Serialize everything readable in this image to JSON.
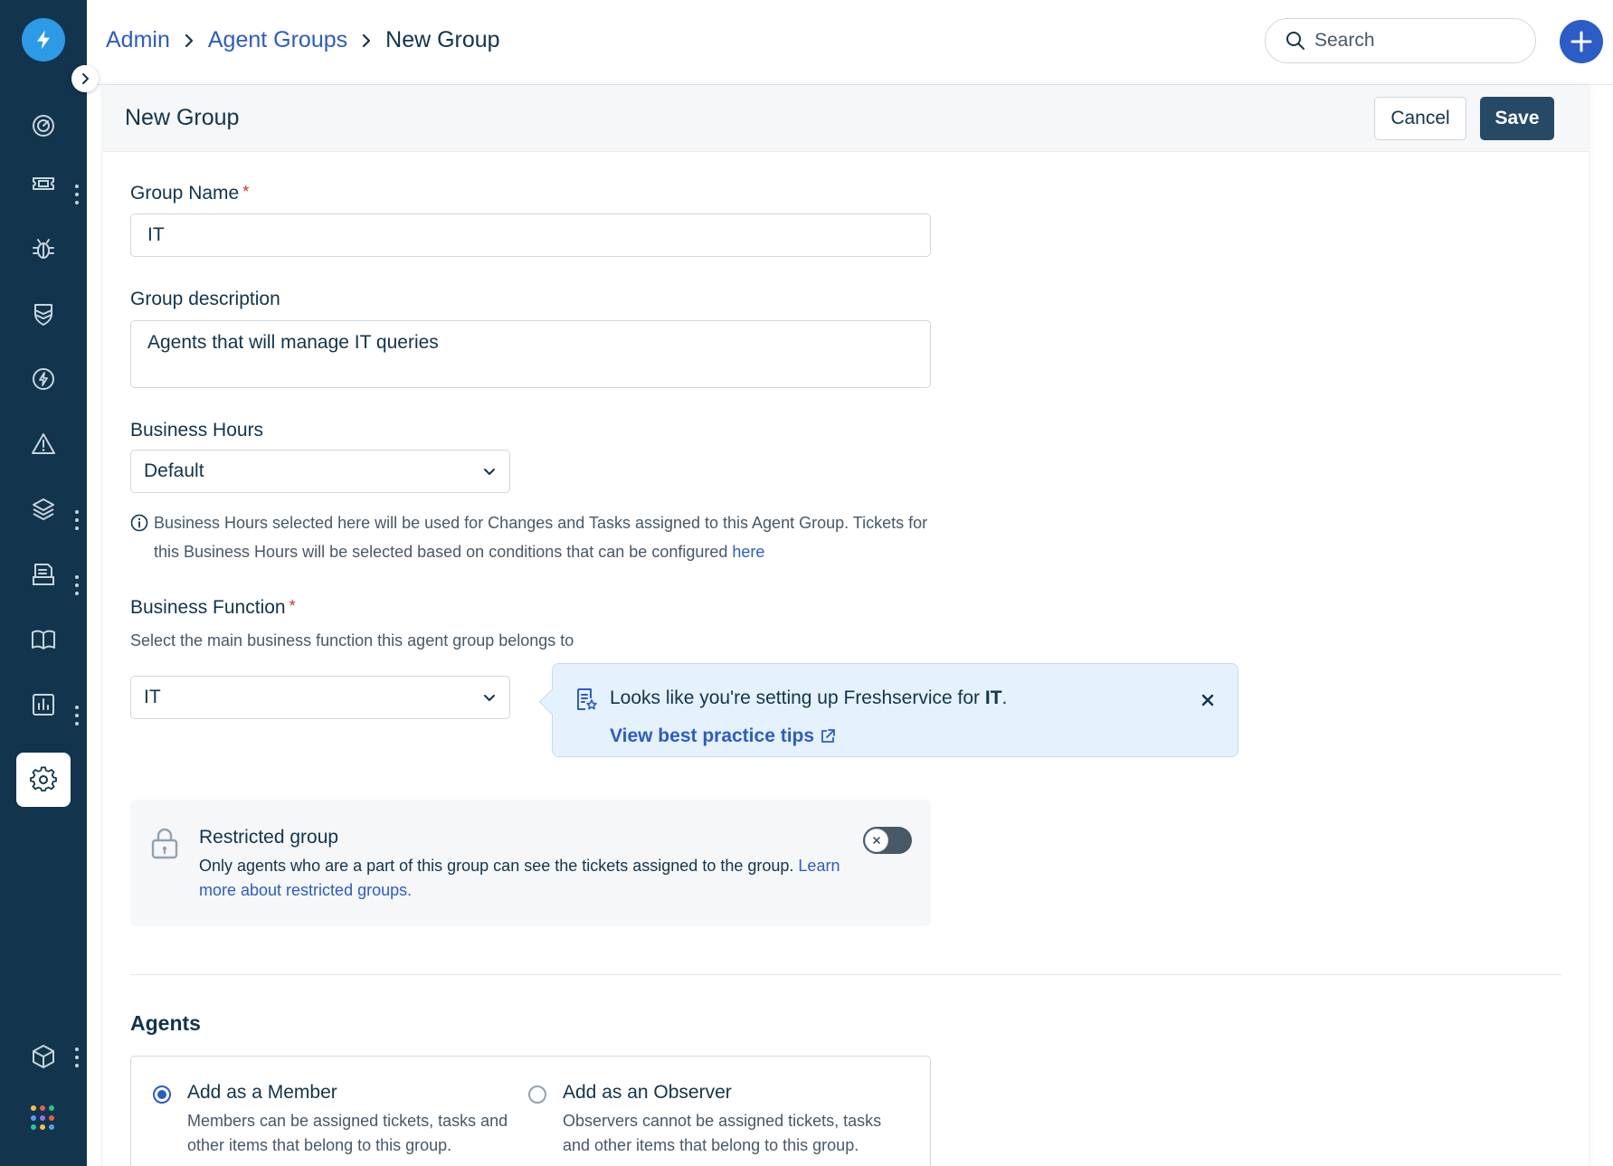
{
  "breadcrumb": {
    "admin": "Admin",
    "agent_groups": "Agent Groups",
    "current": "New Group"
  },
  "search": {
    "placeholder": "Search"
  },
  "page": {
    "title": "New Group",
    "cancel_label": "Cancel",
    "save_label": "Save"
  },
  "form": {
    "group_name": {
      "label": "Group Name",
      "required_mark": "*",
      "value": "IT"
    },
    "group_description": {
      "label": "Group description",
      "value": "Agents that will manage IT queries"
    },
    "business_hours": {
      "label": "Business Hours",
      "value": "Default",
      "hint_line1": "Business Hours selected here will be used for Changes and Tasks assigned to this Agent Group. Tickets for",
      "hint_line2": "this Business Hours will be selected based on conditions that can be configured",
      "hint_link": "here"
    },
    "business_function": {
      "label": "Business Function",
      "required_mark": "*",
      "subtitle": "Select the main business function this agent group belongs to",
      "value": "IT"
    }
  },
  "tip": {
    "text_prefix": "Looks like you're setting up Freshservice for",
    "text_bold": "IT",
    "text_suffix": ".",
    "link": "View best practice tips"
  },
  "restricted": {
    "title": "Restricted group",
    "desc": "Only agents who are a part of this group can see the tickets assigned to the group.",
    "link": "Learn more about restricted groups",
    "link_suffix": ".",
    "enabled": false
  },
  "agents": {
    "title": "Agents",
    "member": {
      "title": "Add as a Member",
      "desc": "Members can be assigned tickets, tasks and other items that belong to this group.",
      "selected": true
    },
    "observer": {
      "title": "Add as an Observer",
      "desc": "Observers cannot be assigned tickets, tasks and other items that belong to this group.",
      "selected": false
    }
  },
  "colors": {
    "sidebar": "#12344d",
    "logo": "#2c9ae6",
    "link": "#2c5cc5",
    "primary_button": "#264966",
    "tip_background": "#e5f2fd",
    "required": "#d72d30"
  },
  "icons": {
    "sidebar": [
      "dashboard-icon",
      "tickets-icon",
      "problems-icon",
      "changes-icon",
      "releases-icon",
      "alerts-icon",
      "assets-icon",
      "inbox-icon",
      "solutions-icon",
      "reports-icon",
      "admin-gear-icon",
      "cube-icon",
      "apps-grid-icon"
    ]
  }
}
